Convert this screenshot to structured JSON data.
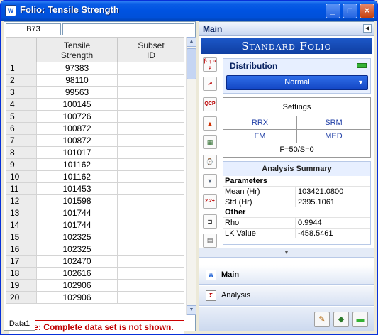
{
  "window": {
    "title": "Folio: Tensile Strength",
    "minimize": "_",
    "maximize": "□",
    "close": "✕",
    "app_icon": "W"
  },
  "sheet": {
    "cell_ref": "B73",
    "formula": "",
    "columns": [
      "",
      "Tensile\nStrength",
      "Subset\nID"
    ],
    "rows": [
      {
        "n": "1",
        "v": "97383",
        "s": ""
      },
      {
        "n": "2",
        "v": "98110",
        "s": ""
      },
      {
        "n": "3",
        "v": "99563",
        "s": ""
      },
      {
        "n": "4",
        "v": "100145",
        "s": ""
      },
      {
        "n": "5",
        "v": "100726",
        "s": ""
      },
      {
        "n": "6",
        "v": "100872",
        "s": ""
      },
      {
        "n": "7",
        "v": "100872",
        "s": ""
      },
      {
        "n": "8",
        "v": "101017",
        "s": ""
      },
      {
        "n": "9",
        "v": "101162",
        "s": ""
      },
      {
        "n": "10",
        "v": "101162",
        "s": ""
      },
      {
        "n": "11",
        "v": "101453",
        "s": ""
      },
      {
        "n": "12",
        "v": "101598",
        "s": ""
      },
      {
        "n": "13",
        "v": "101744",
        "s": ""
      },
      {
        "n": "14",
        "v": "101744",
        "s": ""
      },
      {
        "n": "15",
        "v": "102325",
        "s": ""
      },
      {
        "n": "16",
        "v": "102325",
        "s": ""
      },
      {
        "n": "17",
        "v": "102470",
        "s": ""
      },
      {
        "n": "18",
        "v": "102616",
        "s": ""
      },
      {
        "n": "19",
        "v": "102906",
        "s": ""
      },
      {
        "n": "20",
        "v": "102906",
        "s": ""
      }
    ],
    "note": "Note: Complete data set is not shown.",
    "tab": "Data1"
  },
  "panel": {
    "header": "Main",
    "collapse_btn": "◀",
    "banner": "Standard Folio",
    "side_icons": [
      "β η σ μ",
      "↗",
      "QCP",
      "▲",
      "▦",
      "⌚",
      "▼",
      "2.2+",
      "⊐",
      "▤"
    ],
    "distribution": {
      "title": "Distribution",
      "selected": "Normal",
      "arrow": "▼"
    },
    "settings": {
      "title": "Settings",
      "rrx": "RRX",
      "srm": "SRM",
      "fm": "FM",
      "med": "MED",
      "footer": "F=50/S=0"
    },
    "analysis": {
      "title": "Analysis Summary",
      "parameters_label": "Parameters",
      "mean_label": "Mean (Hr)",
      "mean_value": "103421.0800",
      "std_label": "Std (Hr)",
      "std_value": "2395.1061",
      "other_label": "Other",
      "rho_label": "Rho",
      "rho_value": "0.9944",
      "lk_label": "LK Value",
      "lk_value": "-458.5461"
    },
    "collapse_arrow": "▼",
    "nav_main": "Main",
    "nav_analysis": "Analysis",
    "bottom_buttons": [
      "✎",
      "◆",
      "▬"
    ]
  },
  "colors": {
    "title_bar": "#0053e1",
    "note_red": "#c00000",
    "banner_blue": "#1c57c7",
    "settings_link": "#1f3ea6"
  }
}
